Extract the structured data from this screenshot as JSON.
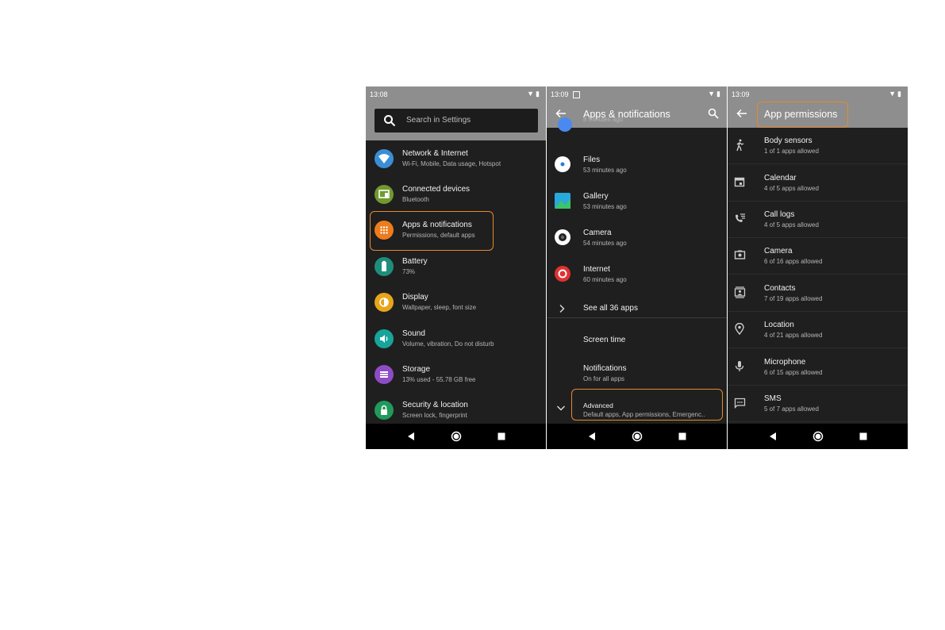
{
  "panel1": {
    "status": {
      "time": "13:08"
    },
    "search_placeholder": "Search in Settings",
    "items": [
      {
        "title": "Network & Internet",
        "subtitle": "Wi-Fi, Mobile, Data usage, Hotspot",
        "color": "#3b8ed6",
        "icon": "wifi-icon"
      },
      {
        "title": "Connected devices",
        "subtitle": "Bluetooth",
        "color": "#6f9a2e",
        "icon": "devices-icon"
      },
      {
        "title": "Apps & notifications",
        "subtitle": "Permissions, default apps",
        "color": "#ee7c1b",
        "icon": "apps-icon"
      },
      {
        "title": "Battery",
        "subtitle": "73%",
        "color": "#1e8e7c",
        "icon": "battery-icon"
      },
      {
        "title": "Display",
        "subtitle": "Wallpaper, sleep, font size",
        "color": "#e7a51a",
        "icon": "brightness-icon"
      },
      {
        "title": "Sound",
        "subtitle": "Volume, vibration, Do not disturb",
        "color": "#17a49a",
        "icon": "volume-icon"
      },
      {
        "title": "Storage",
        "subtitle": "13% used - 55.78 GB free",
        "color": "#8e4bc6",
        "icon": "storage-icon"
      },
      {
        "title": "Security & location",
        "subtitle": "Screen lock, fingerprint",
        "color": "#1f9a5a",
        "icon": "lock-icon"
      }
    ]
  },
  "panel2": {
    "status": {
      "time": "13:09"
    },
    "title": "Apps & notifications",
    "partial_subtitle": "8 minutes ago",
    "apps": [
      {
        "title": "Files",
        "subtitle": "53 minutes ago",
        "icon": "files-icon"
      },
      {
        "title": "Gallery",
        "subtitle": "53 minutes ago",
        "icon": "gallery-icon"
      },
      {
        "title": "Camera",
        "subtitle": "54 minutes ago",
        "icon": "camera-app-icon"
      },
      {
        "title": "Internet",
        "subtitle": "60 minutes ago",
        "icon": "internet-icon"
      }
    ],
    "see_all": "See all 36 apps",
    "screen_time": "Screen time",
    "notifications": {
      "title": "Notifications",
      "subtitle": "On for all apps"
    },
    "advanced": {
      "title": "Advanced",
      "subtitle": "Default apps, App permissions, Emergenc.."
    }
  },
  "panel3": {
    "status": {
      "time": "13:09"
    },
    "title": "App permissions",
    "permissions": [
      {
        "title": "Body sensors",
        "subtitle": "1 of 1 apps allowed",
        "icon": "body-sensors-icon"
      },
      {
        "title": "Calendar",
        "subtitle": "4 of 5 apps allowed",
        "icon": "calendar-icon"
      },
      {
        "title": "Call logs",
        "subtitle": "4 of 5 apps allowed",
        "icon": "call-log-icon"
      },
      {
        "title": "Camera",
        "subtitle": "6 of 16 apps allowed",
        "icon": "camera-icon"
      },
      {
        "title": "Contacts",
        "subtitle": "7 of 19 apps allowed",
        "icon": "contacts-icon"
      },
      {
        "title": "Location",
        "subtitle": "4 of 21 apps allowed",
        "icon": "location-icon"
      },
      {
        "title": "Microphone",
        "subtitle": "6 of 15 apps allowed",
        "icon": "microphone-icon"
      },
      {
        "title": "SMS",
        "subtitle": "5 of 7 apps allowed",
        "icon": "sms-icon"
      }
    ]
  },
  "colors": {
    "highlight": "#e7892c",
    "appbar": "#8e8e8e",
    "background": "#1f1f1f"
  }
}
